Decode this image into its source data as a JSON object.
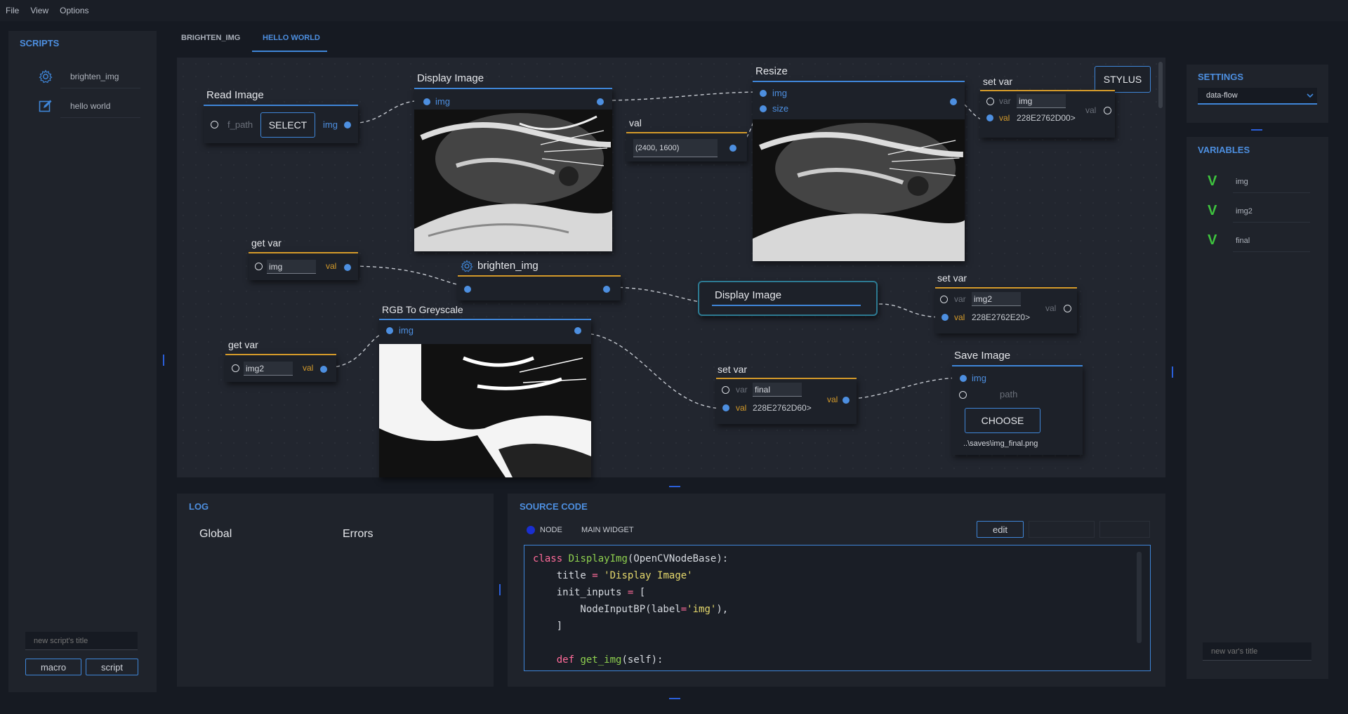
{
  "menu": [
    "File",
    "View",
    "Options"
  ],
  "scripts_panel": {
    "title": "SCRIPTS",
    "items": [
      {
        "label": "brighten_img",
        "icon": "gear-icon"
      },
      {
        "label": "hello world",
        "icon": "edit-icon"
      }
    ],
    "new_title_placeholder": "new script's title",
    "macro_label": "macro",
    "script_label": "script"
  },
  "tabs": [
    {
      "label": "BRIGHTEN_IMG",
      "active": false
    },
    {
      "label": "HELLO WORLD",
      "active": true
    }
  ],
  "flow": {
    "stylus_label": "STYLUS",
    "read_image": {
      "title": "Read Image",
      "in_label": "f_path",
      "select_label": "SELECT",
      "out_label": "img"
    },
    "display_image_1": {
      "title": "Display Image",
      "in_label": "img"
    },
    "val_node": {
      "title": "val",
      "value": "(2400, 1600)"
    },
    "resize": {
      "title": "Resize",
      "in1": "img",
      "in2": "size"
    },
    "set_var_1": {
      "title": "set var",
      "var_label": "var",
      "var_value": "img",
      "val_label": "val",
      "val_value": "228E2762D00>",
      "out_label": "val"
    },
    "get_var_1": {
      "title": "get var",
      "value": "img",
      "out_label": "val"
    },
    "brighten": {
      "title": "brighten_img"
    },
    "display_image_2": {
      "title": "Display Image"
    },
    "set_var_2": {
      "title": "set var",
      "var_label": "var",
      "var_value": "img2",
      "val_label": "val",
      "val_value": "228E2762E20>",
      "out_label": "val"
    },
    "rgb_grey": {
      "title": "RGB To Greyscale",
      "in_label": "img"
    },
    "get_var_2": {
      "title": "get var",
      "value": "img2",
      "out_label": "val"
    },
    "set_var_3": {
      "title": "set var",
      "var_label": "var",
      "var_value": "final",
      "val_label": "val",
      "val_value": "228E2762D60>",
      "out_label": "val"
    },
    "save_image": {
      "title": "Save Image",
      "in_label": "img",
      "path_label": "path",
      "choose_label": "CHOOSE",
      "path_value": "..\\saves\\img_final.png"
    }
  },
  "log": {
    "title": "LOG",
    "tabs": [
      "Global",
      "Errors"
    ]
  },
  "source_code": {
    "title": "SOURCE CODE",
    "radio_node": "NODE",
    "radio_widget": "MAIN WIDGET",
    "edit_label": "edit"
  },
  "settings": {
    "title": "SETTINGS",
    "mode": "data-flow"
  },
  "variables": {
    "title": "VARIABLES",
    "items": [
      "img",
      "img2",
      "final"
    ],
    "new_var_placeholder": "new var's title"
  },
  "colors": {
    "accent": "#4d8fe0",
    "exec_orange": "#d49a2a",
    "var_green": "#3ec43e",
    "background": "#161a22",
    "panel": "#1f232b"
  }
}
